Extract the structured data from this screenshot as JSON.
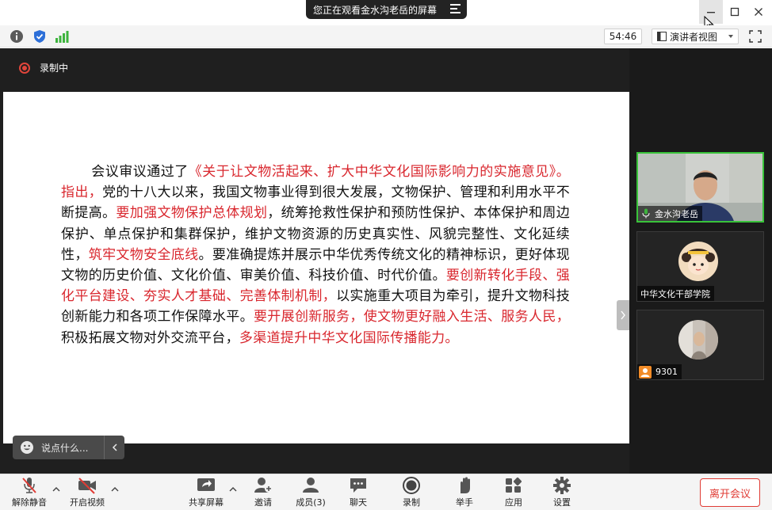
{
  "share_banner": {
    "text": "您正在观看金水沟老岳的屏幕"
  },
  "toolbar": {
    "timer": "54:46",
    "view_label": "演讲者视图"
  },
  "recording": {
    "label": "录制中"
  },
  "document": {
    "paragraph": [
      {
        "t": "会议审议通过了",
        "red": false
      },
      {
        "t": "《关于让文物活起来、扩大中华文化国际影响力的实施意见》。指出，",
        "red": true
      },
      {
        "t": "党的十八大以来，我国文物事业得到很大发展，文物保护、管理和利用水平不断提高。",
        "red": false
      },
      {
        "t": "要加强文物保护总体规划",
        "red": true
      },
      {
        "t": "，统筹抢救性保护和预防性保护、本体保护和周边保护、单点保护和集群保护，维护文物资源的历史真实性、风貌完整性、文化延续性，",
        "red": false
      },
      {
        "t": "筑牢文物安全底线",
        "red": true
      },
      {
        "t": "。要准确提炼并展示中华优秀传统文化的精神标识，更好体现文物的历史价值、文化价值、审美价值、科技价值、时代价值。",
        "red": false
      },
      {
        "t": "要创新转化手段、强化平台建设、夯实人才基础、完善体制机制，",
        "red": true
      },
      {
        "t": "以实施重大项目为牵引，提升文物科技创新能力和各项工作保障水平。",
        "red": false
      },
      {
        "t": "要开展创新服务，使文物更好融入生活、服务人民，",
        "red": true
      },
      {
        "t": "积极拓展文物对外交流平台，",
        "red": false
      },
      {
        "t": "多渠道提升中华文化国际传播能力。",
        "red": true
      }
    ]
  },
  "chat": {
    "placeholder": "说点什么..."
  },
  "participants": [
    {
      "name": "金水沟老岳",
      "active": true
    },
    {
      "name": "中华文化干部学院",
      "active": false
    },
    {
      "name": "9301",
      "active": false
    }
  ],
  "controls": {
    "unmute": "解除静音",
    "start_video": "开启视频",
    "share_screen": "共享屏幕",
    "invite": "邀请",
    "participants": "成员(3)",
    "chat": "聊天",
    "record": "录制",
    "raise_hand": "举手",
    "apps": "应用",
    "settings": "设置",
    "leave": "离开会议"
  },
  "colors": {
    "accent_red": "#d9272e",
    "active_speaker": "#39c33a",
    "leave_red": "#e03c35"
  }
}
